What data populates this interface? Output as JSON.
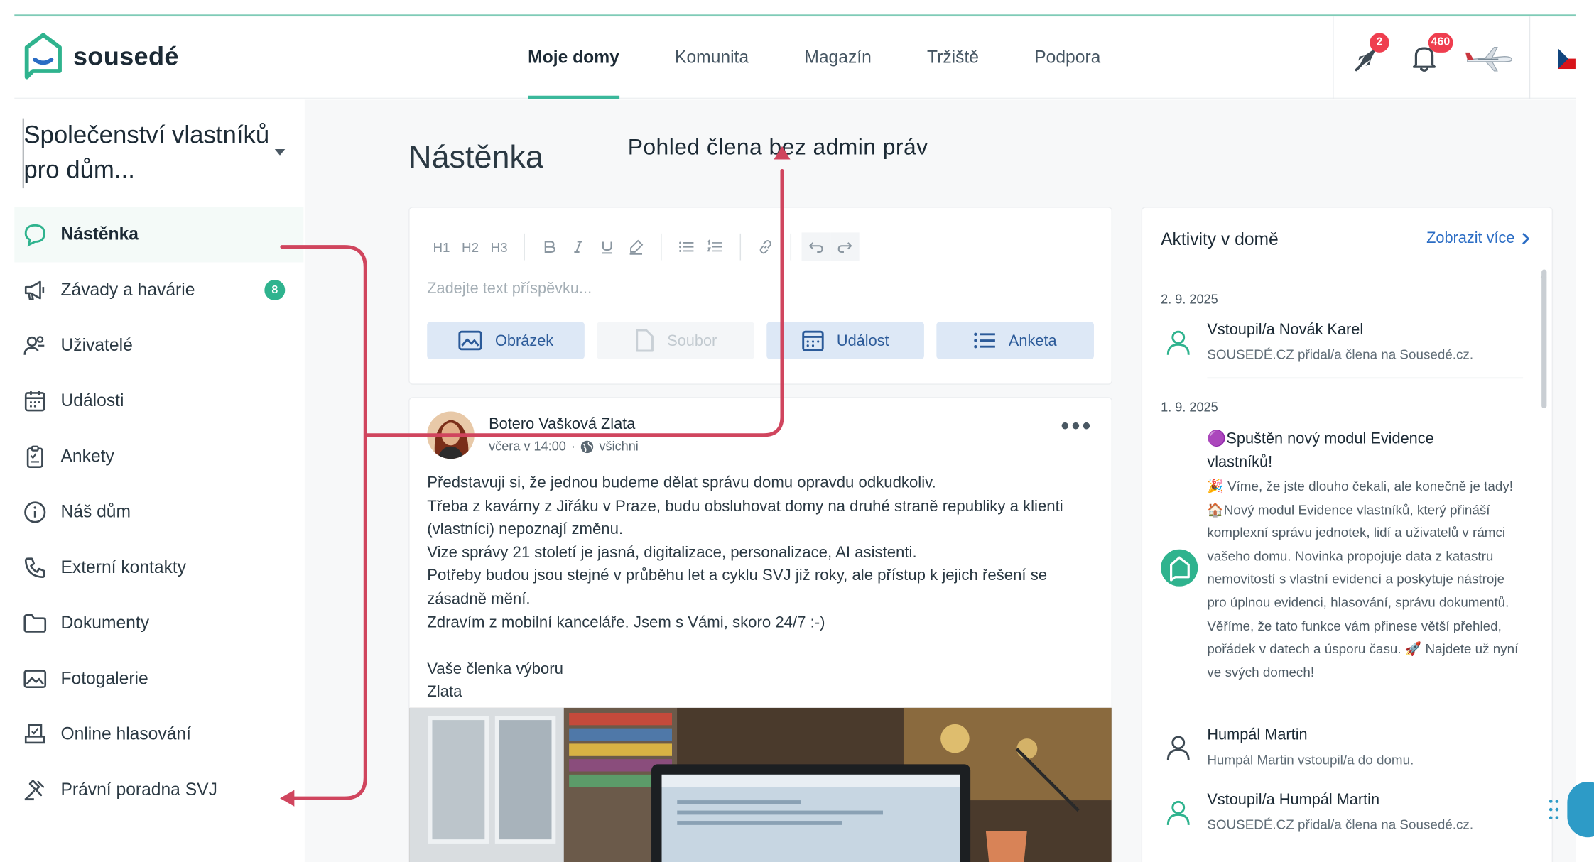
{
  "app": {
    "brand": "sousedé",
    "nav": [
      "Moje domy",
      "Komunita",
      "Magazín",
      "Tržiště",
      "Podpora"
    ],
    "active_nav": "Moje domy",
    "notifications": {
      "rocket_count": "2",
      "bell_count": "460"
    }
  },
  "sidebar": {
    "community_name": "Společenství vlastníků pro dům...",
    "items": [
      {
        "label": "Nástěnka",
        "icon": "chat-bubble-icon",
        "active": true
      },
      {
        "label": "Závady a havárie",
        "icon": "megaphone-icon",
        "badge": "8"
      },
      {
        "label": "Uživatelé",
        "icon": "users-icon"
      },
      {
        "label": "Události",
        "icon": "calendar-icon"
      },
      {
        "label": "Ankety",
        "icon": "clipboard-icon"
      },
      {
        "label": "Náš dům",
        "icon": "info-icon"
      },
      {
        "label": "Externí kontakty",
        "icon": "phone-icon"
      },
      {
        "label": "Dokumenty",
        "icon": "folder-icon"
      },
      {
        "label": "Fotogalerie",
        "icon": "image-icon"
      },
      {
        "label": "Online hlasování",
        "icon": "ballot-icon"
      },
      {
        "label": "Právní poradna SVJ",
        "icon": "gavel-icon"
      }
    ]
  },
  "page": {
    "title": "Nástěnka",
    "annotation": "Pohled člena bez admin práv"
  },
  "composer": {
    "toolbar": [
      "H1",
      "H2",
      "H3"
    ],
    "placeholder": "Zadejte text příspěvku...",
    "buttons": {
      "image": "Obrázek",
      "file": "Soubor",
      "event": "Událost",
      "poll": "Anketa"
    }
  },
  "post": {
    "author": "Botero Vašková Zlata",
    "time": "včera v 14:00",
    "audience": "všichni",
    "lines": [
      "Představuji si, že jednou budeme dělat správu domu opravdu odkudkoliv.",
      "Třeba z kavárny z Jiřáku v Praze, budu obsluhovat domy na druhé straně republiky a klienti (vlastníci) nepoznají změnu.",
      "Vize správy 21 století je jasná, digitalizace, personalizace, AI asistenti.",
      "Potřeby budou jsou stejné v průběhu let a cyklu SVJ již roky, ale přístup k jejich řešení se zásadně mění.",
      "Zdravím z mobilní kanceláře. Jsem s Vámi, skoro 24/7 :-)",
      "",
      "Vaše členka výboru",
      "Zlata"
    ]
  },
  "activity": {
    "title": "Aktivity v domě",
    "more": "Zobrazit více",
    "date1": "2. 9. 2025",
    "item1": {
      "head": "Vstoupil/a Novák Karel",
      "sub": "SOUSEDÉ.CZ přidal/a člena na Sousedé.cz."
    },
    "date2": "1. 9. 2025",
    "item2": {
      "head": "🟣Spuštěn nový modul Evidence vlastníků!",
      "body": "🎉 Víme, že jste dlouho čekali, ale konečně je tady! 🏠Nový modul Evidence vlastníků, který přináší komplexní správu jednotek, lidí a uživatelů v rámci vašeho domu. Novinka propojuje data z katastru nemovitostí s vlastní evidencí a poskytuje nástroje pro úplnou evidenci, hlasování, správu dokumentů. Věříme, že tato funkce vám přinese větší přehled, pořádek v datech a úsporu času. 🚀 Najdete už nyní ve svých domech!"
    },
    "item3": {
      "head": "Humpál Martin",
      "sub": "Humpál Martin vstoupil/a do domu."
    },
    "item4": {
      "head": "Vstoupil/a Humpál Martin",
      "sub": "SOUSEDÉ.CZ přidal/a člena na Sousedé.cz."
    }
  },
  "colors": {
    "accent": "#3bb89b",
    "annotation_arrow": "#d0455e",
    "link": "#2a6cc4"
  }
}
